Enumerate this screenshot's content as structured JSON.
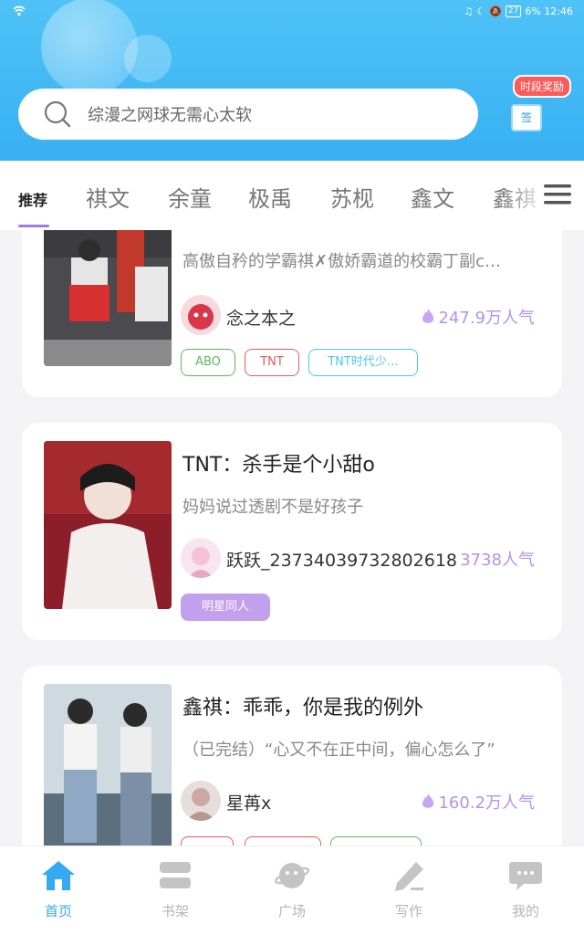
{
  "status": {
    "right": "6%  12:46",
    "battery": "27"
  },
  "search": {
    "placeholder": "综漫之网球无需心太软"
  },
  "reward": {
    "badge": "时段奖励",
    "box": "签"
  },
  "tabs": [
    "推荐",
    "祺文",
    "余童",
    "极禹",
    "苏枧",
    "鑫文",
    "鑫祺"
  ],
  "books": [
    {
      "title": "",
      "desc": "高傲自矜的学霸祺✗傲娇霸道的校霸丁副c…",
      "author": "念之本之",
      "popularity": "247.9万人气",
      "tags": [
        {
          "label": "ABO",
          "color": "#5cb85c"
        },
        {
          "label": "TNT",
          "color": "#e8595a"
        },
        {
          "label": "TNT时代少…",
          "color": "#4fc3f7"
        }
      ]
    },
    {
      "title": "TNT：杀手是个小甜o",
      "desc": "妈妈说过透剧不是好孩子",
      "author": "跃跃_23734039732802618",
      "popularity": "3738人气",
      "tags": [
        {
          "label": "明星同人",
          "color": "#c3a0ee"
        }
      ]
    },
    {
      "title": "鑫祺：乖乖，你是我的例外",
      "desc": "（已完结）“心又不在正中间，偏心怎么了”",
      "author": "星苒x",
      "popularity": "160.2万人气",
      "tags": [
        {
          "label": "",
          "color": "#e8595a"
        },
        {
          "label": "",
          "color": "#e8595a"
        },
        {
          "label": "",
          "color": "#5cb85c"
        }
      ]
    }
  ],
  "nav": [
    {
      "label": "首页",
      "icon": "home-icon"
    },
    {
      "label": "书架",
      "icon": "bookshelf-icon"
    },
    {
      "label": "广场",
      "icon": "planet-icon"
    },
    {
      "label": "写作",
      "icon": "pen-icon"
    },
    {
      "label": "我的",
      "icon": "chat-bubble-icon"
    }
  ]
}
